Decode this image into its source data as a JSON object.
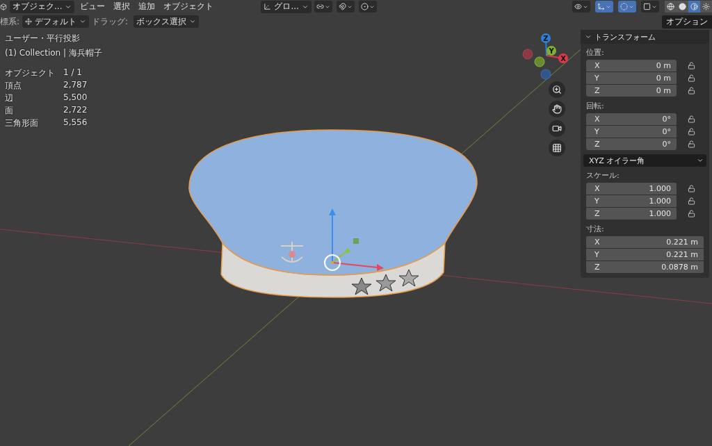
{
  "header": {
    "mode": "オブジェク...",
    "menus": [
      "ビュー",
      "選択",
      "追加",
      "オブジェクト"
    ],
    "orientation": "グロ...",
    "toggles": [
      {
        "kind": "pivot",
        "on": false
      },
      {
        "kind": "snap",
        "on": false
      },
      {
        "kind": "proportional",
        "on": false
      }
    ],
    "view_toggles": [
      {
        "kind": "visibility",
        "on": false
      },
      {
        "kind": "gizmos",
        "on": true
      },
      {
        "kind": "overlays",
        "on": true
      },
      {
        "kind": "xray",
        "on": false
      }
    ],
    "shading": [
      {
        "kind": "wireframe",
        "selected": false
      },
      {
        "kind": "solid",
        "selected": false
      },
      {
        "kind": "material",
        "selected": true
      },
      {
        "kind": "rendered",
        "selected": false
      }
    ]
  },
  "tool_settings": {
    "orientation_label": "標系:",
    "orientation_value": "デフォルト",
    "drag_label": "ドラッグ:",
    "drag_value": "ボックス選択",
    "options": "オプション"
  },
  "viewport": {
    "view_name": "ユーザー・平行投影",
    "collection": "(1) Collection | 海兵帽子",
    "stats": [
      {
        "label": "オブジェクト",
        "value": "1 / 1"
      },
      {
        "label": "頂点",
        "value": "2,787"
      },
      {
        "label": "辺",
        "value": "5,500"
      },
      {
        "label": "面",
        "value": "2,722"
      },
      {
        "label": "三角形面",
        "value": "5,556"
      }
    ],
    "axes": [
      "Z",
      "Y",
      "X"
    ]
  },
  "sidebar": {
    "title": "トランスフォーム",
    "expanded": true,
    "sections": [
      {
        "kind": "locked_vector",
        "label": "位置:",
        "fields": [
          {
            "axis": "X",
            "value": "0 m",
            "locked": false
          },
          {
            "axis": "Y",
            "value": "0 m",
            "locked": false
          },
          {
            "axis": "Z",
            "value": "0 m",
            "locked": false
          }
        ]
      },
      {
        "kind": "locked_vector",
        "label": "回転:",
        "fields": [
          {
            "axis": "X",
            "value": "0°",
            "locked": false
          },
          {
            "axis": "Y",
            "value": "0°",
            "locked": false
          },
          {
            "axis": "Z",
            "value": "0°",
            "locked": false
          }
        ]
      },
      {
        "kind": "dropdown",
        "value": "XYZ オイラー角"
      },
      {
        "kind": "locked_vector",
        "label": "スケール:",
        "fields": [
          {
            "axis": "X",
            "value": "1.000",
            "locked": false
          },
          {
            "axis": "Y",
            "value": "1.000",
            "locked": false
          },
          {
            "axis": "Z",
            "value": "1.000",
            "locked": false
          }
        ]
      },
      {
        "kind": "vector",
        "label": "寸法:",
        "fields": [
          {
            "axis": "X",
            "value": "0.221 m"
          },
          {
            "axis": "Y",
            "value": "0.221 m"
          },
          {
            "axis": "Z",
            "value": "0.0878 m"
          }
        ]
      }
    ]
  }
}
